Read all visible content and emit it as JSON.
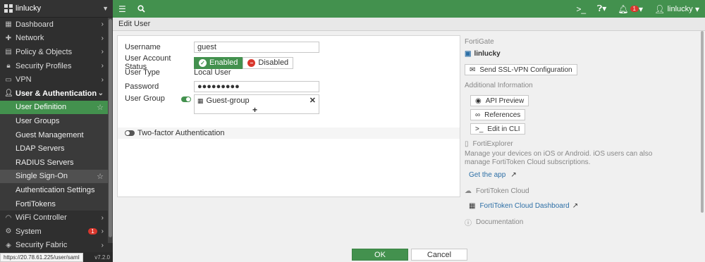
{
  "sidebar": {
    "device_name": "linlucky",
    "items": [
      {
        "label": "Dashboard",
        "icon": "dashboard-icon"
      },
      {
        "label": "Network",
        "icon": "network-icon"
      },
      {
        "label": "Policy & Objects",
        "icon": "policy-icon"
      },
      {
        "label": "Security Profiles",
        "icon": "lock-icon"
      },
      {
        "label": "VPN",
        "icon": "monitor-icon"
      },
      {
        "label": "User & Authentication",
        "icon": "user-icon"
      },
      {
        "label": "User Definition"
      },
      {
        "label": "User Groups"
      },
      {
        "label": "Guest Management"
      },
      {
        "label": "LDAP Servers"
      },
      {
        "label": "RADIUS Servers"
      },
      {
        "label": "Single Sign-On"
      },
      {
        "label": "Authentication Settings"
      },
      {
        "label": "FortiTokens"
      },
      {
        "label": "WiFi Controller",
        "icon": "wifi-icon"
      },
      {
        "label": "System",
        "icon": "gear-icon",
        "badge": "1"
      },
      {
        "label": "Security Fabric",
        "icon": "fabric-icon"
      }
    ],
    "version": "v7.2.0",
    "status_url": "https://20.78.61.225/user/saml"
  },
  "topbar": {
    "notification_count": "1",
    "username": "linlucky"
  },
  "page": {
    "title": "Edit User"
  },
  "form": {
    "username_label": "Username",
    "username_value": "guest",
    "status_label": "User Account Status",
    "enabled_label": "Enabled",
    "disabled_label": "Disabled",
    "type_label": "User Type",
    "type_value": "Local User",
    "password_label": "Password",
    "password_value": "●●●●●●●●●",
    "group_label": "User Group",
    "group_value": "Guest-group",
    "twofa_label": "Two-factor Authentication"
  },
  "right": {
    "fortigate_section": "FortiGate",
    "device": "linlucky",
    "send_ssl_label": "Send SSL-VPN Configuration",
    "additional_section": "Additional Information",
    "api_preview_label": "API Preview",
    "references_label": "References",
    "edit_cli_label": "Edit in CLI",
    "fortiexplorer_title": "FortiExplorer",
    "fortiexplorer_text": "Manage your devices on iOS or Android. iOS users can also manage FortiToken Cloud subscriptions.",
    "get_app_label": "Get the app",
    "fortitoken_title": "FortiToken Cloud",
    "fortitoken_dashboard_label": "FortiToken Cloud Dashboard",
    "documentation_title": "Documentation"
  },
  "footer": {
    "ok_label": "OK",
    "cancel_label": "Cancel"
  },
  "colors": {
    "accent": "#43914e",
    "danger": "#d9372d",
    "link": "#2d6fa6"
  }
}
